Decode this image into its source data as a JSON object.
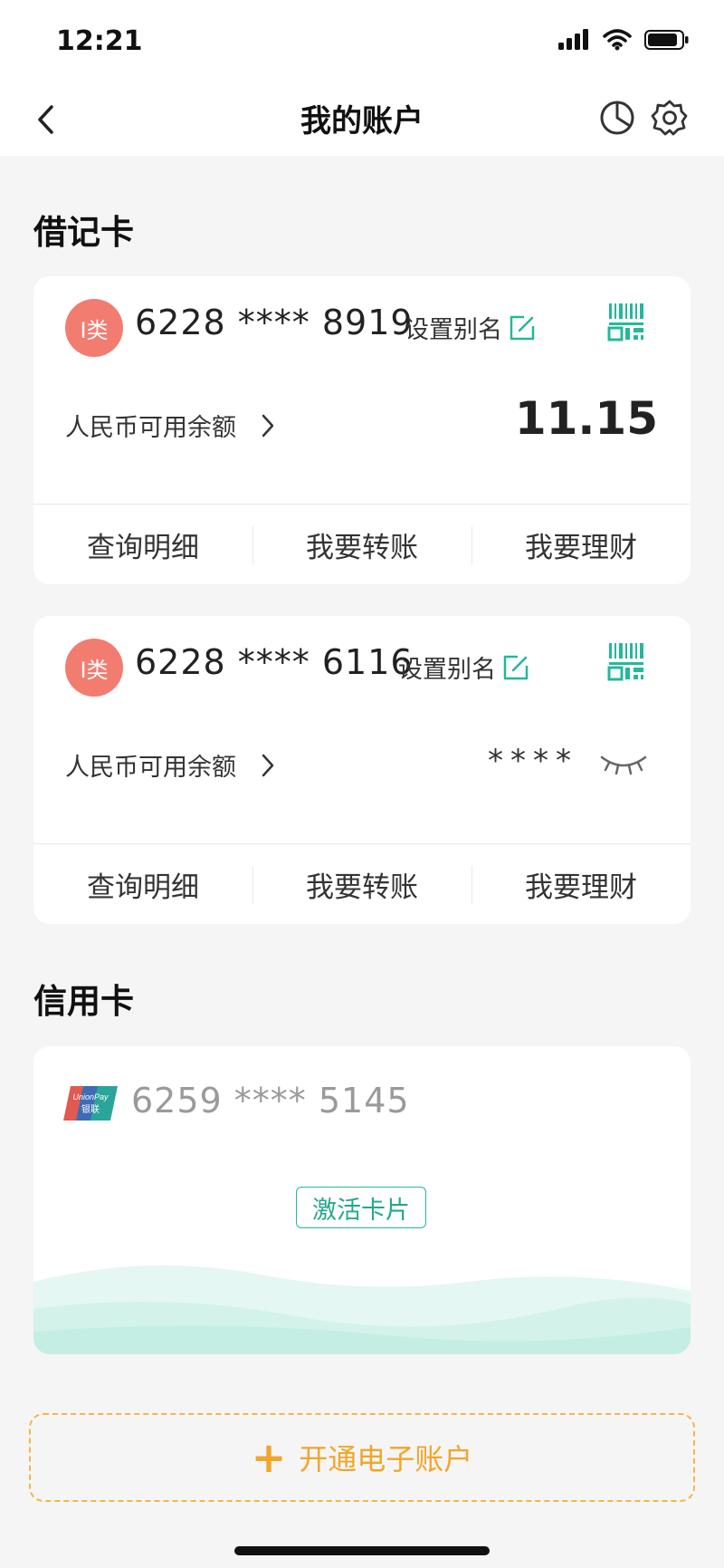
{
  "status_bar": {
    "time": "12:21"
  },
  "nav": {
    "title": "我的账户"
  },
  "debit": {
    "section_title": "借记卡",
    "cards": [
      {
        "badge": "I类",
        "number": "6228 **** 8919",
        "alias_label": "设置别名",
        "balance_label": "人民币可用余额",
        "balance": "11.15",
        "actions": [
          "查询明细",
          "我要转账",
          "我要理财"
        ]
      },
      {
        "badge": "I类",
        "number": "6228 **** 6116",
        "alias_label": "设置别名",
        "balance_label": "人民币可用余额",
        "balance": "****",
        "actions": [
          "查询明细",
          "我要转账",
          "我要理财"
        ]
      }
    ]
  },
  "credit": {
    "section_title": "信用卡",
    "card": {
      "number": "6259 **** 5145",
      "activate_label": "激活卡片"
    }
  },
  "open_account": {
    "label": "开通电子账户"
  },
  "icons": {
    "back": "chevron-left-icon",
    "stats": "pie-chart-icon",
    "settings": "gear-icon",
    "alias_edit": "edit-icon",
    "qr": "qr-code-icon",
    "eye": "eye-closed-icon"
  },
  "colors": {
    "accent_green": "#23b89b",
    "badge_red": "#f27c70",
    "open_orange": "#f2a52a"
  }
}
